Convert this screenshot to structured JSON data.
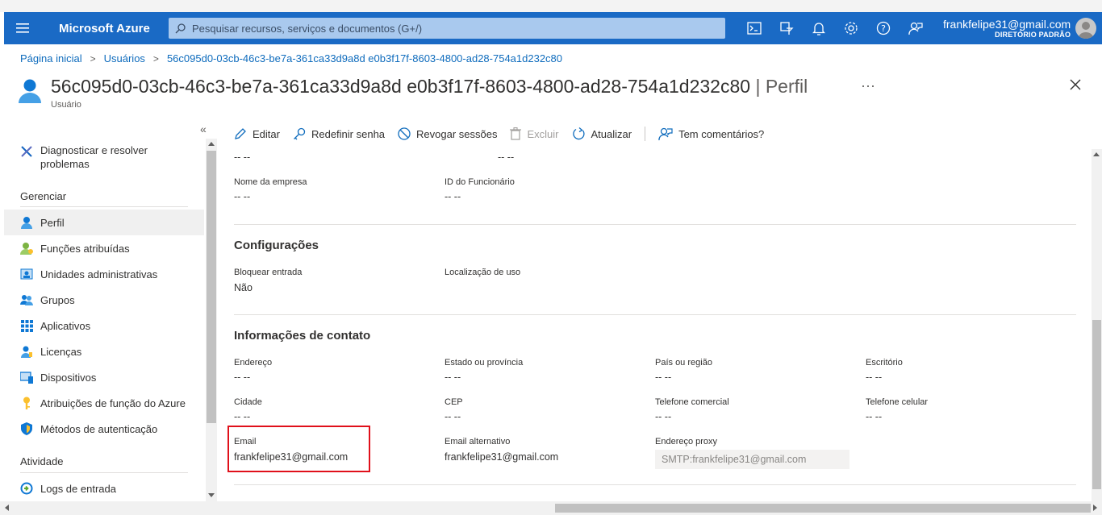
{
  "topbar": {
    "brand": "Microsoft Azure",
    "search_placeholder": "Pesquisar recursos, serviços e documentos (G+/)",
    "account_email": "frankfelipe31@gmail.com",
    "account_directory": "DIRETÓRIO PADRÃO",
    "icons": [
      "cloud-shell-icon",
      "directory-filter-icon",
      "notifications-icon",
      "settings-icon",
      "help-icon",
      "feedback-icon"
    ]
  },
  "breadcrumb": {
    "items": [
      "Página inicial",
      "Usuários",
      "56c095d0-03cb-46c3-be7a-361ca33d9a8d e0b3f17f-8603-4800-ad28-754a1d232c80"
    ]
  },
  "page": {
    "title": "56c095d0-03cb-46c3-be7a-361ca33d9a8d e0b3f17f-8603-4800-ad28-754a1d232c80",
    "title_separator": "|",
    "title_suffix": "Perfil",
    "subtitle": "Usuário",
    "more": "···"
  },
  "sidebar": {
    "collapse_glyph": "«",
    "diagnose": "Diagnosticar e resolver problemas",
    "sections": {
      "manage": "Gerenciar",
      "activity": "Atividade"
    },
    "items": [
      {
        "label": "Perfil",
        "icon": "user-icon"
      },
      {
        "label": "Funções atribuídas",
        "icon": "roles-icon"
      },
      {
        "label": "Unidades administrativas",
        "icon": "admin-units-icon"
      },
      {
        "label": "Grupos",
        "icon": "groups-icon"
      },
      {
        "label": "Aplicativos",
        "icon": "apps-grid-icon"
      },
      {
        "label": "Licenças",
        "icon": "license-icon"
      },
      {
        "label": "Dispositivos",
        "icon": "devices-icon"
      },
      {
        "label": "Atribuições de função do Azure",
        "icon": "key-icon"
      },
      {
        "label": "Métodos de autenticação",
        "icon": "shield-icon"
      }
    ],
    "activity_items": [
      {
        "label": "Logs de entrada",
        "icon": "sign-in-logs-icon"
      }
    ]
  },
  "commands": {
    "edit": "Editar",
    "reset_password": "Redefinir senha",
    "revoke_sessions": "Revogar sessões",
    "delete": "Excluir",
    "refresh": "Atualizar",
    "feedback": "Tem comentários?"
  },
  "profile": {
    "top_values": [
      "-- --",
      "-- --"
    ],
    "company_name_label": "Nome da empresa",
    "company_name_value": "-- --",
    "employee_id_label": "ID do Funcionário",
    "employee_id_value": "-- --",
    "settings_title": "Configurações",
    "block_signin_label": "Bloquear entrada",
    "block_signin_value": "Não",
    "usage_location_label": "Localização de uso",
    "contact_title": "Informações de contato",
    "address_label": "Endereço",
    "address_value": "-- --",
    "state_label": "Estado ou província",
    "state_value": "-- --",
    "country_label": "País ou região",
    "country_value": "-- --",
    "office_label": "Escritório",
    "office_value": "-- --",
    "city_label": "Cidade",
    "city_value": "-- --",
    "zip_label": "CEP",
    "zip_value": "-- --",
    "business_phone_label": "Telefone comercial",
    "business_phone_value": "-- --",
    "mobile_phone_label": "Telefone celular",
    "mobile_phone_value": "-- --",
    "email_label": "Email",
    "email_value": "frankfelipe31@gmail.com",
    "alt_email_label": "Email alternativo",
    "alt_email_value": "frankfelipe31@gmail.com",
    "proxy_label": "Endereço proxy",
    "proxy_value": "SMTP:frankfelipe31@gmail.com"
  },
  "colors": {
    "topbar": "#1a6ac5",
    "link": "#0f6cbd",
    "highlight_box": "#e0101a"
  }
}
